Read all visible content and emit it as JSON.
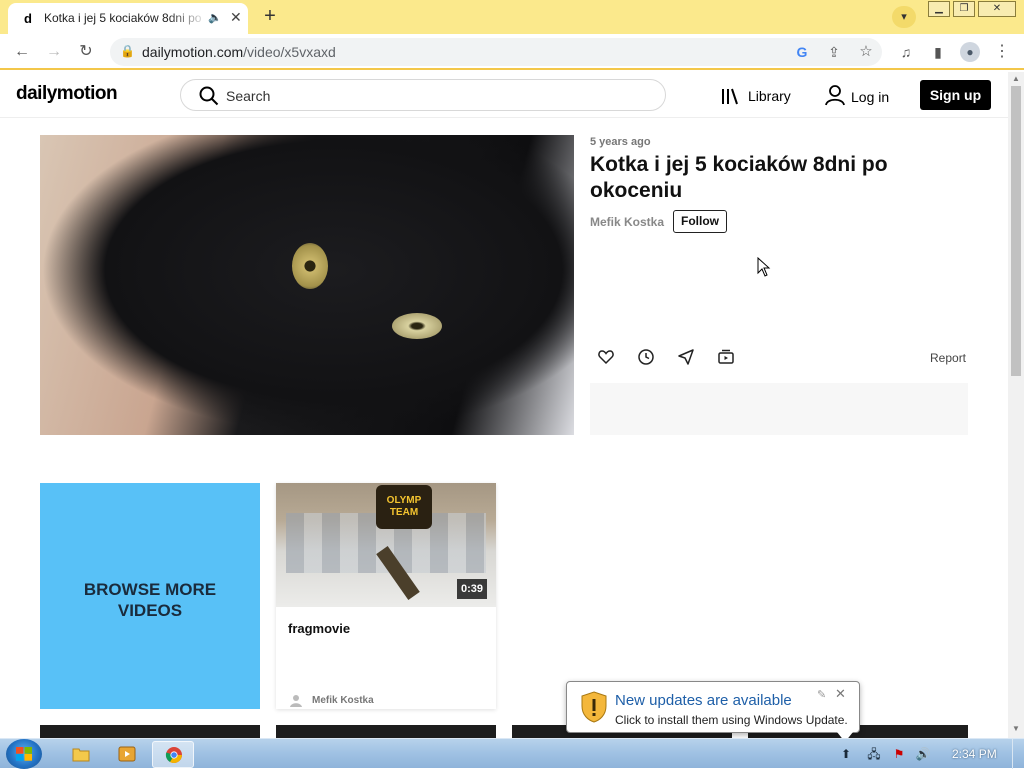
{
  "browser": {
    "tab_title": "Kotka i jej 5 kociaków 8dni po okoceniu",
    "tab_favicon": "d",
    "url_host": "dailymotion.com",
    "url_path": "/video/x5vxaxd"
  },
  "site": {
    "logo": "dailymotion",
    "search_placeholder": "Search",
    "library_label": "Library",
    "login_label": "Log in",
    "signup_label": "Sign up"
  },
  "video": {
    "age": "5 years ago",
    "title": "Kotka i jej 5 kociaków 8dni po okoceniu",
    "channel": "Mefik Kostka",
    "follow_label": "Follow",
    "report_label": "Report"
  },
  "related": {
    "browse_label": "BROWSE MORE\nVIDEOS",
    "items": [
      {
        "title": "fragmovie",
        "duration": "0:39",
        "channel": "Mefik Kostka",
        "badge": "OLYMP TEAM"
      }
    ]
  },
  "notification": {
    "title": "New updates are available",
    "body": "Click to install them using Windows Update."
  },
  "taskbar": {
    "clock": "2:34 PM"
  },
  "colors": {
    "tabbar_bg": "#fbe98c",
    "browse_bg": "#58c1f7",
    "signup_bg": "#000000"
  }
}
